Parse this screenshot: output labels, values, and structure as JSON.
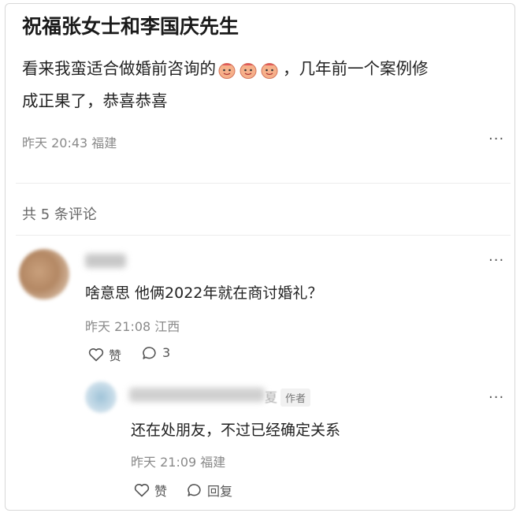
{
  "post": {
    "title": "祝福张女士和李国庆先生",
    "line1_prefix": "看来我蛮适合做婚前咨询的",
    "line1_suffix": "，几年前一个案例修",
    "line2": "成正果了，恭喜恭喜",
    "emoji": "smiling-face-emoji",
    "meta": "昨天 20:43 福建",
    "more": "···"
  },
  "comments_count": "共 5 条评论",
  "comment": {
    "text": "啥意思 他俩2022年就在商讨婚礼？",
    "meta": "昨天 21:08 江西",
    "like_label": "赞",
    "reply_count": "3",
    "more": "···"
  },
  "reply": {
    "author_suffix": "夏",
    "author_tag": "作者",
    "text": "还在处朋友，不过已经确定关系",
    "meta": "昨天 21:09 福建",
    "like_label": "赞",
    "reply_label": "回复",
    "more": "···"
  },
  "colors": {
    "accent_emoji": "#f6b08a",
    "meta_gray": "#8a8a8a"
  }
}
